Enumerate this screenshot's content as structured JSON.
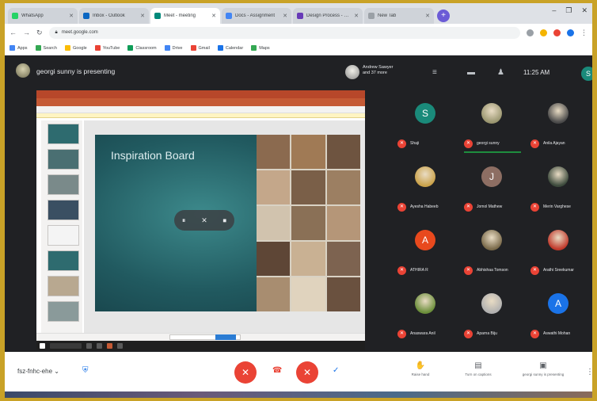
{
  "browser": {
    "tabs": [
      {
        "title": "WhatsApp",
        "color": "#25d366",
        "active": false
      },
      {
        "title": "Inbox - Outlook",
        "color": "#0a66c2",
        "active": false
      },
      {
        "title": "Meet - meeting",
        "color": "#00897b",
        "active": true
      },
      {
        "title": "Docs - Assignment",
        "color": "#4285f4",
        "active": false
      },
      {
        "title": "Design Process - Google",
        "color": "#673ab7",
        "active": false
      },
      {
        "title": "New Tab",
        "color": "#9aa0a6",
        "active": false
      }
    ],
    "new_tab": "+",
    "window_controls": [
      "–",
      "❐",
      "✕"
    ],
    "url": "meet.google.com",
    "bookmarks": [
      {
        "label": "Apps",
        "color": "#4285f4"
      },
      {
        "label": "Search",
        "color": "#34a853"
      },
      {
        "label": "Google",
        "color": "#fbbc05"
      },
      {
        "label": "YouTube",
        "color": "#ea4335"
      },
      {
        "label": "Classroom",
        "color": "#0f9d58"
      },
      {
        "label": "Drive",
        "color": "#4285f4"
      },
      {
        "label": "Gmail",
        "color": "#ea4335"
      },
      {
        "label": "Calendar",
        "color": "#1a73e8"
      },
      {
        "label": "Maps",
        "color": "#34a853"
      }
    ]
  },
  "meet": {
    "presenting_text": "georgi sunny is presenting",
    "user_line1": "Andrew Sawyer",
    "user_line2": "and 37 more",
    "clock": "11:25 AM",
    "my_initial": "S",
    "participants": [
      {
        "name": "Shaji",
        "initial": "S",
        "color": "#1a8a7a",
        "photo": false,
        "speaking": false
      },
      {
        "name": "georgi sunny",
        "initial": "",
        "color": "#9a9670",
        "photo": true,
        "speaking": true
      },
      {
        "name": "Anila Ajayan",
        "initial": "",
        "color": "#4a4a4a",
        "photo": true,
        "speaking": false
      },
      {
        "name": "Ayesha Habeeb",
        "initial": "",
        "color": "#caa24a",
        "photo": true,
        "speaking": false
      },
      {
        "name": "Jomol Mathew",
        "initial": "J",
        "color": "#8d6e63",
        "photo": false,
        "speaking": false
      },
      {
        "name": "Merin Varghese",
        "initial": "",
        "color": "#3c4a3c",
        "photo": true,
        "speaking": false
      },
      {
        "name": "ATHIRA R",
        "initial": "A",
        "color": "#e8491d",
        "photo": false,
        "speaking": false
      },
      {
        "name": "Abhishaa Tomson",
        "initial": "",
        "color": "#7a6a4a",
        "photo": true,
        "speaking": false
      },
      {
        "name": "Arathi Sreekumar",
        "initial": "",
        "color": "#c0392b",
        "photo": true,
        "speaking": false
      },
      {
        "name": "Anaswara Anil",
        "initial": "",
        "color": "#6b8e3a",
        "photo": true,
        "speaking": false
      },
      {
        "name": "Aparna Biju",
        "initial": "",
        "color": "#b0b0b0",
        "photo": true,
        "speaking": false
      },
      {
        "name": "Aswathi Mohan",
        "initial": "A",
        "color": "#1a73e8",
        "photo": false,
        "speaking": false
      }
    ]
  },
  "slide": {
    "title": "Inspiration Board",
    "pause_icons": [
      "⏸",
      "✕",
      "⏹"
    ],
    "collage_colors": [
      "#8b6a4f",
      "#a07a55",
      "#6e5440",
      "#c4a78a",
      "#7a5f48",
      "#9c7f62",
      "#d1c3ae",
      "#8a7056",
      "#b59678",
      "#5e4636",
      "#c9b193",
      "#7d6350",
      "#a88d70",
      "#e0d3be",
      "#6a513f"
    ]
  },
  "bottom_bar": {
    "meeting_code": "fsz-fnhc-ehe",
    "shield_icon": "⛨",
    "mic_icon": "✕",
    "cam_icon": "✕",
    "actions": [
      {
        "label": "Raise hand",
        "icon": "✋"
      },
      {
        "label": "Turn on captions",
        "icon": "▤"
      },
      {
        "label": "georgi sunny is presenting",
        "icon": "▣"
      }
    ],
    "more_icon": "⋮"
  }
}
